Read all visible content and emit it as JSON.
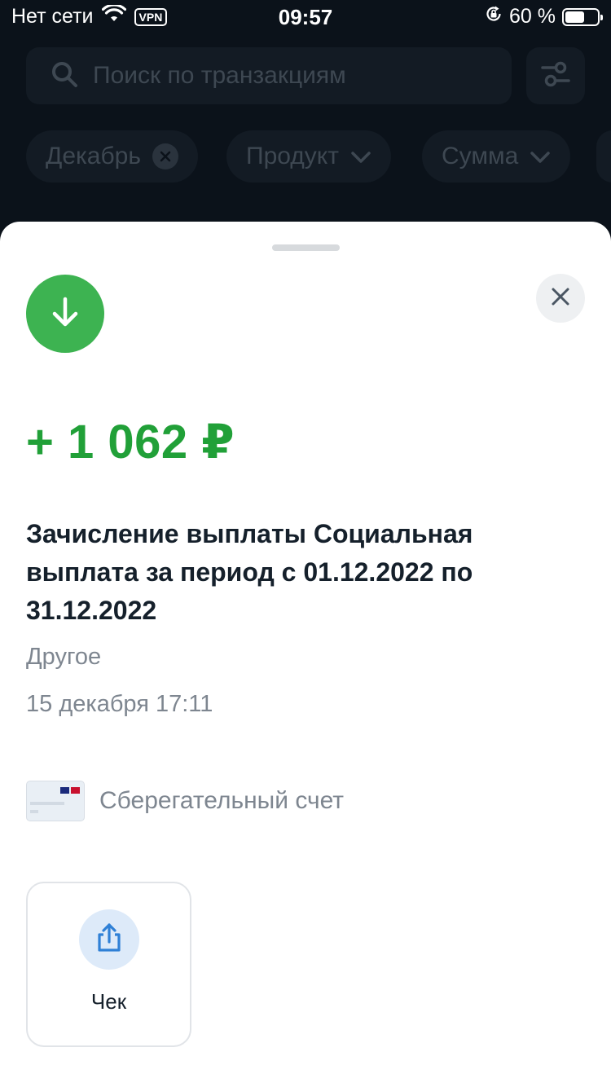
{
  "status_bar": {
    "carrier": "Нет сети",
    "vpn": "VPN",
    "time": "09:57",
    "battery_percent": "60 %",
    "battery_level": 0.6
  },
  "background_screen": {
    "search_placeholder": "Поиск по транзакциям",
    "chips": [
      {
        "label": "Декабрь"
      },
      {
        "label": "Продукт"
      },
      {
        "label": "Сумма"
      }
    ]
  },
  "transaction": {
    "amount": "+ 1 062 ₽",
    "description": "Зачисление выплаты Социальная выплата за период с 01.12.2022 по 31.12.2022",
    "category": "Другое",
    "datetime": "15 декабря 17:11",
    "account": "Сберегательный счет"
  },
  "actions": {
    "receipt_label": "Чек"
  },
  "colors": {
    "income_green": "#21a038",
    "icon_green": "#3db351",
    "share_blue": "#2f80d6"
  },
  "icons": {
    "transaction": "arrow-down-icon",
    "close": "close-icon",
    "receipt": "share-icon",
    "search": "search-icon",
    "filter": "sliders-icon"
  }
}
